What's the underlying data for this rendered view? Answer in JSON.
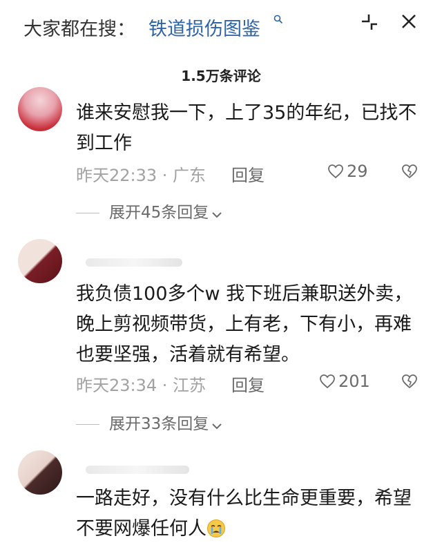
{
  "search_bar": {
    "prefix": "大家都在搜：",
    "query": "铁道损伤图鉴"
  },
  "comments_header": {
    "count_title": "1.5万条评论"
  },
  "comments": [
    {
      "text": "谁来安慰我一下，上了35的年纪，已找不到工作",
      "time_location": "昨天22:33 · 广东",
      "reply_label": "回复",
      "likes": "29",
      "expand_label": "展开45条回复"
    },
    {
      "text": "我负债100多个w 我下班后兼职送外卖，晚上剪视频带货，上有老，下有小，再难也要坚强，活着就有希望。",
      "time_location": "昨天23:34 · 江苏",
      "reply_label": "回复",
      "likes": "201",
      "expand_label": "展开33条回复"
    },
    {
      "text": "一路走好，没有什么比生命更重要，希望不要网爆任何人",
      "emoji": "crying-face-icon"
    }
  ],
  "colors": {
    "link_blue": "#2c64a8",
    "meta_gray": "#a2a2a2",
    "text_dark": "#1a1a1a"
  }
}
